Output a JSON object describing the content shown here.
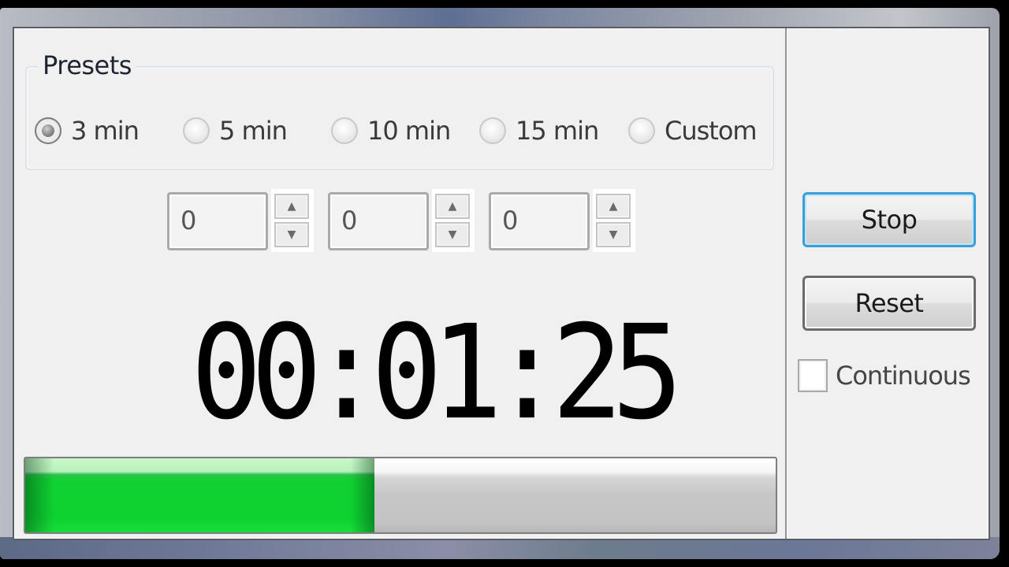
{
  "presets": {
    "title": "Presets",
    "options": [
      {
        "label": "3 min",
        "checked": true
      },
      {
        "label": "5 min",
        "checked": false
      },
      {
        "label": "10 min",
        "checked": false
      },
      {
        "label": "15 min",
        "checked": false
      },
      {
        "label": "Custom",
        "checked": false
      }
    ]
  },
  "custom_time": {
    "hours": "0",
    "minutes": "0",
    "seconds": "0",
    "up_icon": "▲",
    "down_icon": "▼"
  },
  "timer": {
    "display": "00:01:25",
    "progress_fraction": 0.465,
    "progress_color": "#0dd12f"
  },
  "controls": {
    "stop_label": "Stop",
    "reset_label": "Reset",
    "continuous_label": "Continuous",
    "continuous_checked": false
  }
}
